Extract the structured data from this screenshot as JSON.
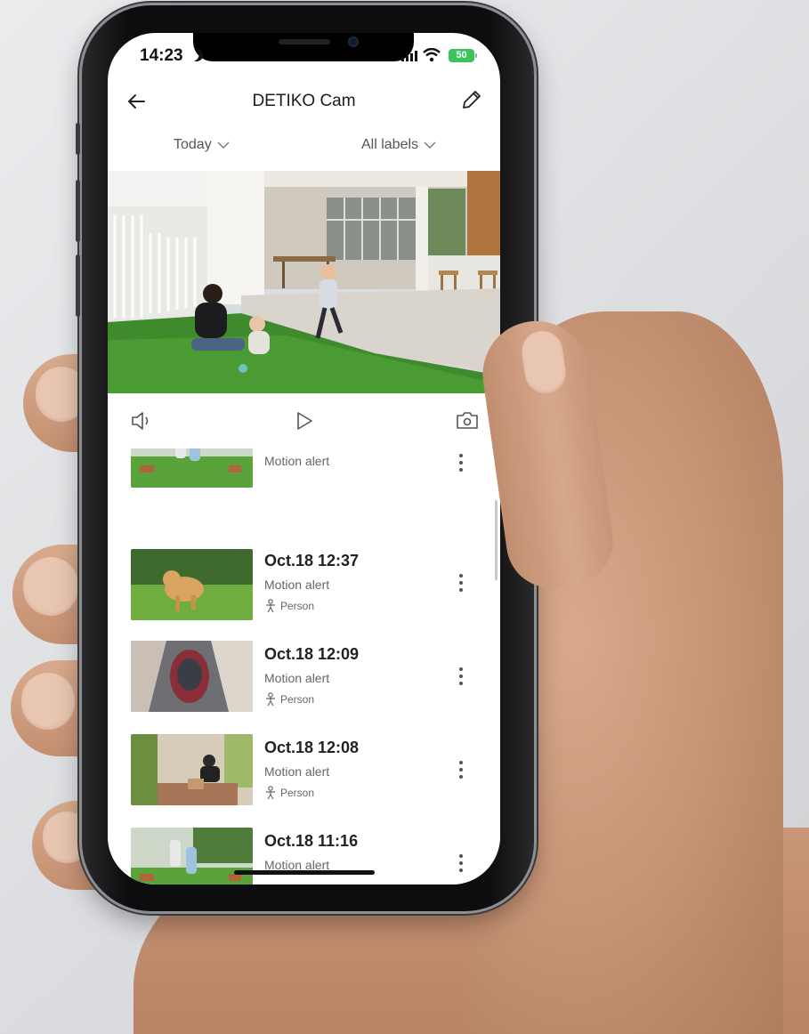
{
  "status_bar": {
    "time": "14:23",
    "battery": "50"
  },
  "header": {
    "title": "DETIKO Cam"
  },
  "filters": {
    "date": "Today",
    "labels": "All labels"
  },
  "icons": {
    "back": "arrow-left-icon",
    "edit": "pencil-icon",
    "speaker": "speaker-icon",
    "play": "play-icon",
    "snapshot": "camera-icon",
    "menu": "more-vertical-icon",
    "person": "person-icon"
  },
  "events": [
    {
      "time": "",
      "type": "Motion alert",
      "tag": ""
    },
    {
      "time": "Oct.18 12:37",
      "type": "Motion alert",
      "tag": "Person"
    },
    {
      "time": "Oct.18 12:09",
      "type": "Motion alert",
      "tag": "Person"
    },
    {
      "time": "Oct.18 12:08",
      "type": "Motion alert",
      "tag": "Person"
    },
    {
      "time": "Oct.18 11:16",
      "type": "Motion alert",
      "tag": ""
    }
  ],
  "colors": {
    "battery": "#3cc35b",
    "accent_text": "#222222"
  }
}
